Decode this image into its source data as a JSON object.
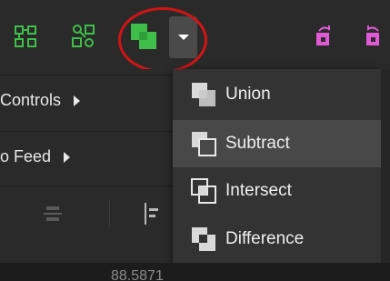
{
  "toolbar": {
    "icons": [
      "ungroup-nodes-icon",
      "group-nodes-icon",
      "boolean-union-icon",
      "chevron-down-icon",
      "rotate-cw-icon",
      "rotate-ccw-icon"
    ],
    "accent_green": "#3fbf4a",
    "accent_pink": "#e05ad6",
    "highlight_color": "#d21414"
  },
  "left_panel": {
    "rows": [
      {
        "label": "Controls"
      },
      {
        "label": "o Feed"
      }
    ],
    "readout": "88.5871"
  },
  "menu": {
    "items": [
      {
        "label": "Union",
        "icon": "union-icon",
        "selected": false
      },
      {
        "label": "Subtract",
        "icon": "subtract-icon",
        "selected": true
      },
      {
        "label": "Intersect",
        "icon": "intersect-icon",
        "selected": false
      },
      {
        "label": "Difference",
        "icon": "difference-icon",
        "selected": false
      }
    ]
  }
}
